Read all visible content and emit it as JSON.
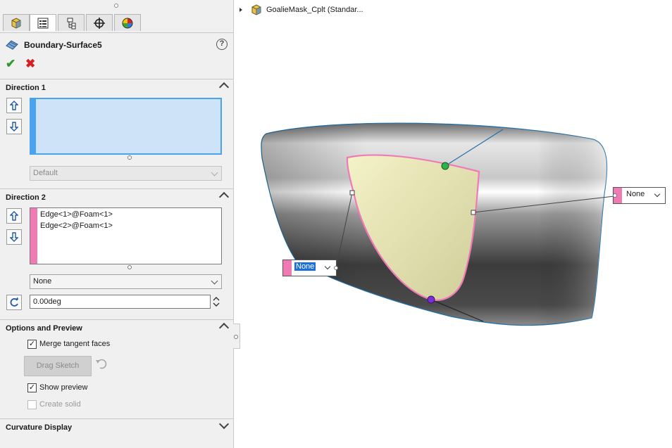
{
  "tree": {
    "root_label": "GoalieMask_Cplt  (Standar..."
  },
  "tabs": [
    {
      "name": "feature-manager",
      "icon": "part-cube-icon"
    },
    {
      "name": "property-manager",
      "icon": "property-list-icon"
    },
    {
      "name": "configuration-manager",
      "icon": "configuration-icon"
    },
    {
      "name": "dimxpert-manager",
      "icon": "crosshair-icon"
    },
    {
      "name": "display-manager",
      "icon": "appearance-pie-icon"
    }
  ],
  "feature": {
    "title": "Boundary-Surface5",
    "help": "?",
    "ok": "✔",
    "cancel": "✖"
  },
  "direction1": {
    "header": "Direction 1",
    "tangent_type": "Default"
  },
  "direction2": {
    "header": "Direction 2",
    "items": [
      "Edge<1>@Foam<1>",
      "Edge<2>@Foam<1>"
    ],
    "tangent_type": "None",
    "angle": "0.00deg"
  },
  "options": {
    "header": "Options and Preview",
    "merge_tangent_faces": "Merge tangent faces",
    "merge_tangent_faces_checked": true,
    "drag_sketch": "Drag Sketch",
    "show_preview": "Show preview",
    "show_preview_checked": true,
    "create_solid": "Create solid",
    "create_solid_checked": false
  },
  "curvature": {
    "header": "Curvature Display"
  },
  "callouts": {
    "left": "None",
    "right": "None"
  },
  "colors": {
    "direction1_accent": "#4aa3f0",
    "direction2_accent": "#ef7ab4",
    "selection_fill": "#cfe3f8",
    "check_green": "#2e9b2e",
    "cancel_red": "#d42020"
  }
}
